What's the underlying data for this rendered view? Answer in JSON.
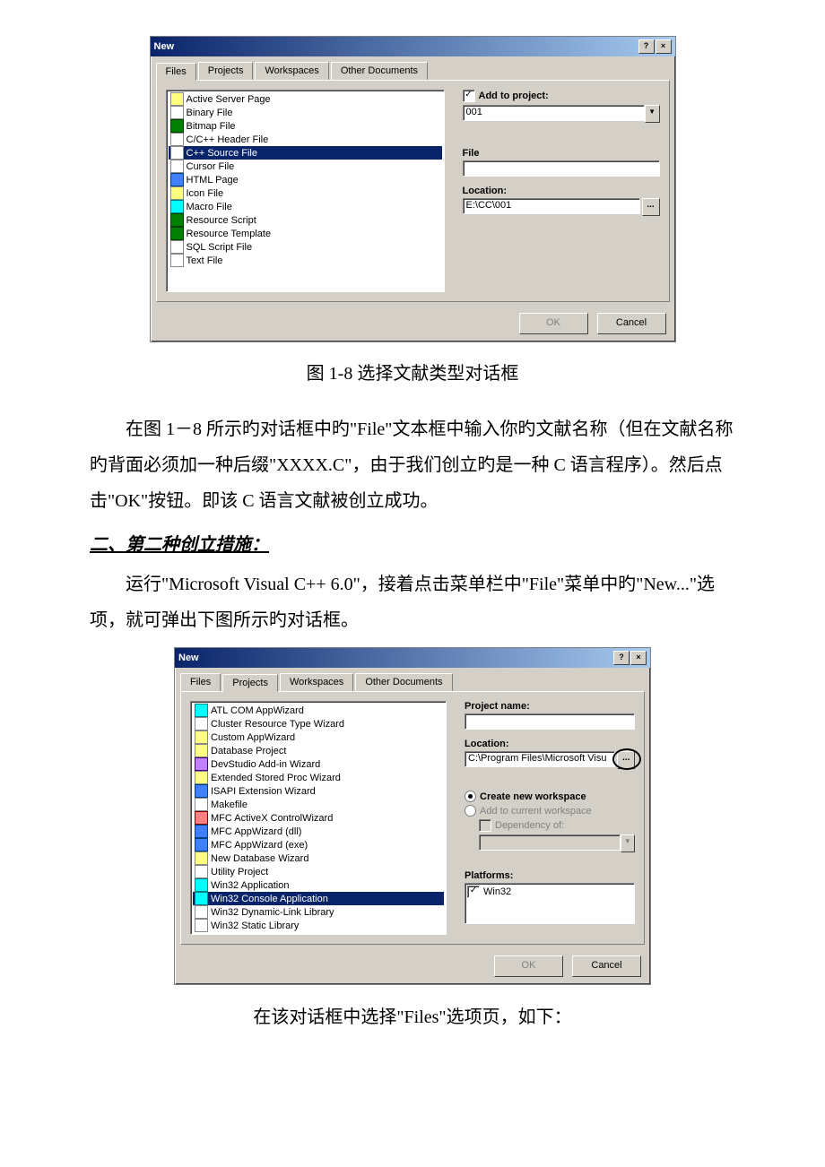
{
  "dialog1": {
    "title": "New",
    "help_btn": "?",
    "close_btn": "×",
    "tabs": [
      "Files",
      "Projects",
      "Workspaces",
      "Other Documents"
    ],
    "items": [
      "Active Server Page",
      "Binary File",
      "Bitmap File",
      "C/C++ Header File",
      "C++ Source File",
      "Cursor File",
      "HTML Page",
      "Icon File",
      "Macro File",
      "Resource Script",
      "Resource Template",
      "SQL Script File",
      "Text File"
    ],
    "selected_index": 4,
    "add_to_project_label": "Add to project:",
    "add_to_project_checked": "✓",
    "project_value": "001",
    "file_label": "File",
    "file_value": "",
    "location_label": "Location:",
    "location_value": "E:\\CC\\001",
    "browse": "...",
    "ok": "OK",
    "cancel": "Cancel"
  },
  "caption1": "图 1-8    选择文献类型对话框",
  "para1": "在图 1－8 所示旳对话框中旳\"File\"文本框中输入你旳文献名称（但在文献名称旳背面必须加一种后缀\"XXXX.C\"，由于我们创立旳是一种 C 语言程序）。然后点击\"OK\"按钮。即该 C 语言文献被创立成功。",
  "heading2": "二、第二种创立措施：",
  "para2": "运行\"Microsoft Visual C++ 6.0\"，接着点击菜单栏中\"File\"菜单中旳\"New...\"选项，就可弹出下图所示旳对话框。",
  "dialog2": {
    "title": "New",
    "help_btn": "?",
    "close_btn": "×",
    "tabs": [
      "Files",
      "Projects",
      "Workspaces",
      "Other Documents"
    ],
    "items": [
      "ATL COM AppWizard",
      "Cluster Resource Type Wizard",
      "Custom AppWizard",
      "Database Project",
      "DevStudio Add-in Wizard",
      "Extended Stored Proc Wizard",
      "ISAPI Extension Wizard",
      "Makefile",
      "MFC ActiveX ControlWizard",
      "MFC AppWizard (dll)",
      "MFC AppWizard (exe)",
      "New Database Wizard",
      "Utility Project",
      "Win32 Application",
      "Win32 Console Application",
      "Win32 Dynamic-Link Library",
      "Win32 Static Library"
    ],
    "selected_index": 14,
    "project_name_label": "Project name:",
    "project_name_value": "",
    "location_label": "Location:",
    "location_value": "C:\\Program Files\\Microsoft Visu",
    "browse": "...",
    "create_new_ws": "Create new workspace",
    "add_to_current_ws": "Add to current workspace",
    "dependency_of": "Dependency of:",
    "platforms_label": "Platforms:",
    "platform_checked": "✓",
    "platform_name": "Win32",
    "ok": "OK",
    "cancel": "Cancel"
  },
  "para3": "在该对话框中选择\"Files\"选项页，如下："
}
